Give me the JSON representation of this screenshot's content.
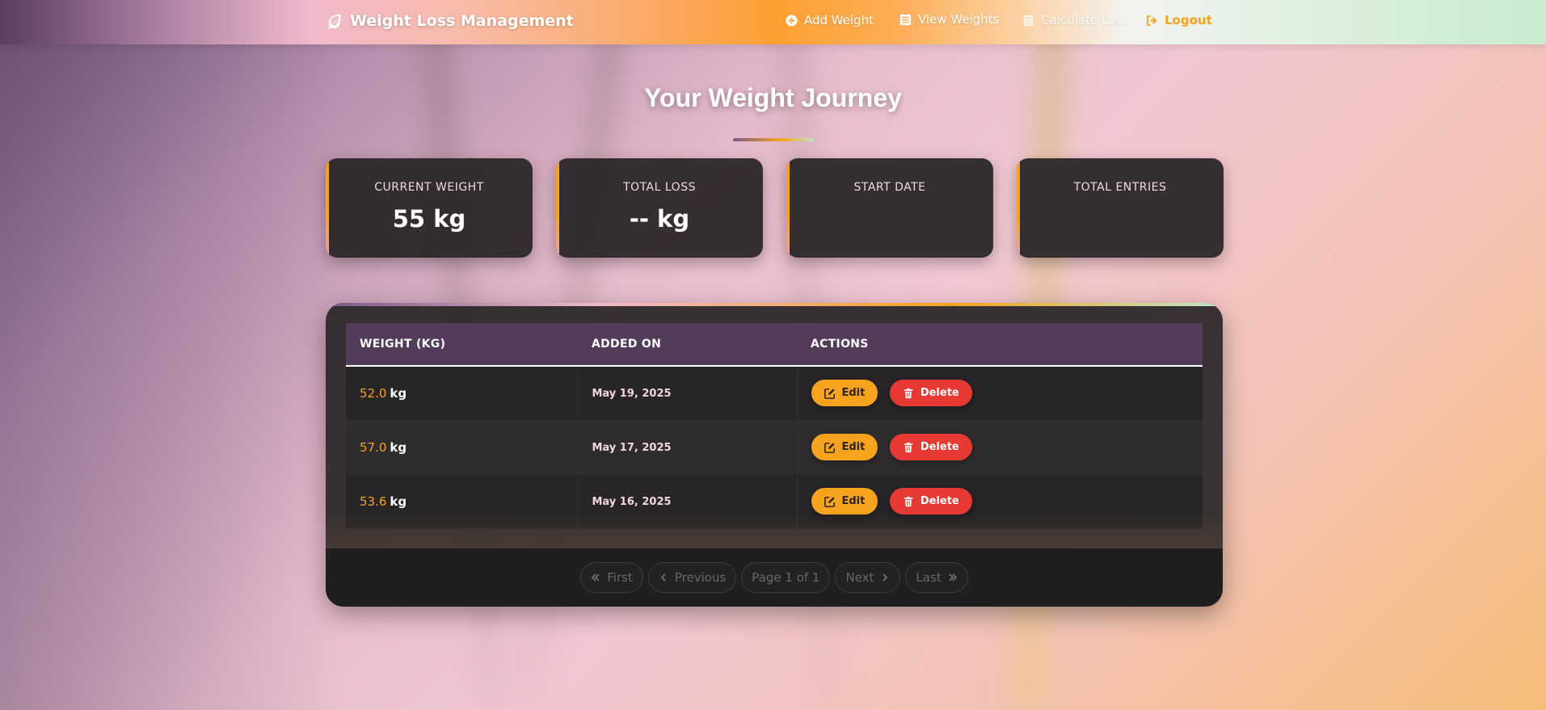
{
  "navbar": {
    "brand": "Weight Loss Management",
    "items": [
      {
        "label": "Add Weight",
        "icon": "plus-circle-icon"
      },
      {
        "label": "View Weights",
        "icon": "list-icon"
      },
      {
        "label": "Calculate Loss",
        "icon": "calculator-icon"
      },
      {
        "label": "Logout",
        "icon": "sign-out-icon"
      }
    ]
  },
  "page": {
    "title": "Your Weight Journey"
  },
  "stats": [
    {
      "label": "CURRENT WEIGHT",
      "value": "55 kg"
    },
    {
      "label": "TOTAL LOSS",
      "value": "-- kg"
    },
    {
      "label": "START DATE",
      "value": ""
    },
    {
      "label": "TOTAL ENTRIES",
      "value": ""
    }
  ],
  "table": {
    "headers": [
      "WEIGHT (KG)",
      "ADDED ON",
      "ACTIONS"
    ],
    "rows": [
      {
        "weight": "52.0",
        "unit": "kg",
        "date": "May 19, 2025",
        "edit": "Edit",
        "delete": "Delete"
      },
      {
        "weight": "57.0",
        "unit": "kg",
        "date": "May 17, 2025",
        "edit": "Edit",
        "delete": "Delete"
      },
      {
        "weight": "53.6",
        "unit": "kg",
        "date": "May 16, 2025",
        "edit": "Edit",
        "delete": "Delete"
      }
    ]
  },
  "pagination": {
    "first": "First",
    "previous": "Previous",
    "page_info": "Page 1 of 1",
    "next": "Next",
    "last": "Last"
  },
  "colors": {
    "accent": "#f7a31e",
    "danger": "#e83a35",
    "header_purple": "#523c5a"
  }
}
